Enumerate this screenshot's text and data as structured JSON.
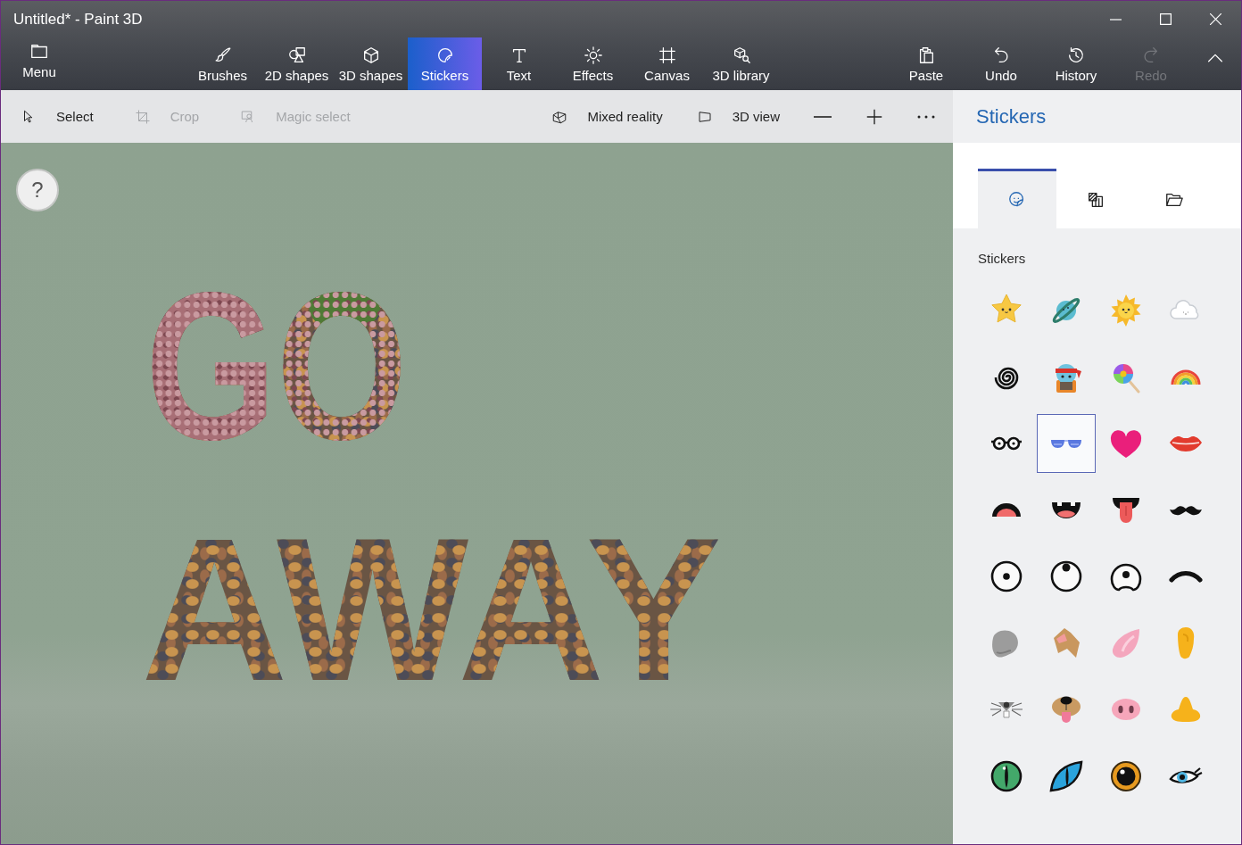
{
  "window": {
    "title": "Untitled* - Paint 3D"
  },
  "ribbon": {
    "menu": {
      "label": "Menu"
    },
    "tools": [
      {
        "label": "Brushes",
        "kind": "brushes",
        "selected": false
      },
      {
        "label": "2D shapes",
        "kind": "shapes2d",
        "selected": false
      },
      {
        "label": "3D shapes",
        "kind": "shapes3d",
        "selected": false
      },
      {
        "label": "Stickers",
        "kind": "stickers",
        "selected": true
      },
      {
        "label": "Text",
        "kind": "text",
        "selected": false
      },
      {
        "label": "Effects",
        "kind": "effects",
        "selected": false
      },
      {
        "label": "Canvas",
        "kind": "canvas",
        "selected": false
      },
      {
        "label": "3D library",
        "kind": "library",
        "selected": false
      }
    ],
    "actions": [
      {
        "label": "Paste",
        "kind": "paste",
        "disabled": false
      },
      {
        "label": "Undo",
        "kind": "undo",
        "disabled": false
      },
      {
        "label": "History",
        "kind": "history",
        "disabled": false
      },
      {
        "label": "Redo",
        "kind": "redo",
        "disabled": true
      }
    ]
  },
  "toolbar": {
    "tools": [
      {
        "label": "Select",
        "kind": "select",
        "disabled": false
      },
      {
        "label": "Crop",
        "kind": "crop",
        "disabled": true
      },
      {
        "label": "Magic select",
        "kind": "magic",
        "disabled": true
      }
    ],
    "view": [
      {
        "label": "Mixed reality",
        "kind": "mixed"
      },
      {
        "label": "3D view",
        "kind": "view3d"
      }
    ]
  },
  "canvas": {
    "help": "?",
    "words": [
      "GO",
      "AWAY"
    ]
  },
  "panel": {
    "title": "Stickers",
    "tabs": [
      {
        "kind": "stickers",
        "selected": true
      },
      {
        "kind": "textures",
        "selected": false
      },
      {
        "kind": "custom",
        "selected": false
      }
    ],
    "section": "Stickers",
    "stickers": [
      {
        "kind": "star",
        "selected": false
      },
      {
        "kind": "planet",
        "selected": false
      },
      {
        "kind": "sun",
        "selected": false
      },
      {
        "kind": "cloud",
        "selected": false
      },
      {
        "kind": "spiral",
        "selected": false
      },
      {
        "kind": "cat",
        "selected": false
      },
      {
        "kind": "lollipop",
        "selected": false
      },
      {
        "kind": "rainbow",
        "selected": false
      },
      {
        "kind": "glasses",
        "selected": false
      },
      {
        "kind": "sunglasses",
        "selected": true
      },
      {
        "kind": "heart",
        "selected": false
      },
      {
        "kind": "lips",
        "selected": false
      },
      {
        "kind": "mouth",
        "selected": false
      },
      {
        "kind": "grin",
        "selected": false
      },
      {
        "kind": "tongue",
        "selected": false
      },
      {
        "kind": "mustache",
        "selected": false
      },
      {
        "kind": "eye",
        "selected": false
      },
      {
        "kind": "eyeup",
        "selected": false
      },
      {
        "kind": "eyehalf",
        "selected": false
      },
      {
        "kind": "brow",
        "selected": false
      },
      {
        "kind": "earround",
        "selected": false
      },
      {
        "kind": "eardog",
        "selected": false
      },
      {
        "kind": "earpointed",
        "selected": false
      },
      {
        "kind": "earhuman",
        "selected": false
      },
      {
        "kind": "nosemouse",
        "selected": false
      },
      {
        "kind": "nosedog",
        "selected": false
      },
      {
        "kind": "nosepig",
        "selected": false
      },
      {
        "kind": "nose",
        "selected": false
      },
      {
        "kind": "eyecat",
        "selected": false
      },
      {
        "kind": "eyecatslant",
        "selected": false
      },
      {
        "kind": "eyeround",
        "selected": false
      },
      {
        "kind": "eyelash",
        "selected": false
      }
    ]
  }
}
